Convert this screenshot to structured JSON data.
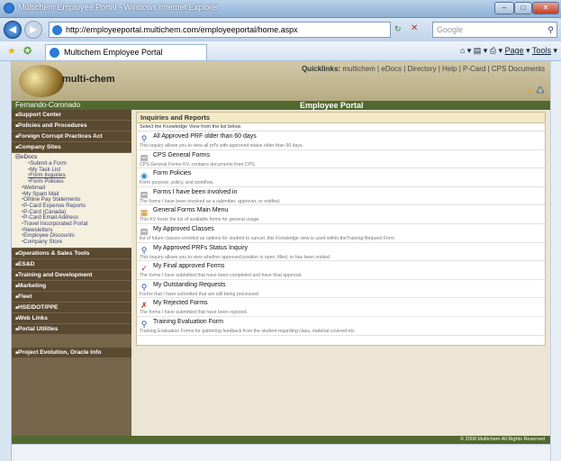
{
  "window": {
    "title": "Multichem Employee Portal - Windows Internet Explorer"
  },
  "address": {
    "url": "http://employeeportal.multichem.com/employeeportal/home.aspx",
    "search_placeholder": "Google"
  },
  "tab": {
    "label": "Multichem Employee Portal"
  },
  "toolbar": {
    "page": "Page",
    "tools": "Tools"
  },
  "header": {
    "logo_text": "multi-chem",
    "quicklinks_label": "Quicklinks:",
    "quicklinks": "multichem | eDocs | Directory | Help | P-Card | CPS Documents"
  },
  "banner": {
    "user": "Fernando-Coronado",
    "portal_title": "Employee Portal"
  },
  "sidebar": {
    "s1": "Support Center",
    "s2": "Policies and Procedures",
    "s3": "Foreign Corrupt Practices Act",
    "s4": "Company Sites",
    "edocs": "eDocs",
    "e1": "Submit a Form",
    "e2": "My Task List",
    "e3": "Form Inquiries",
    "e4": "Form Policies",
    "l1": "Webmail",
    "l2": "My Spam Mail",
    "l3": "Online Pay Statements",
    "l4": "P-Card Expense Reports",
    "l5": "P-Card (Canada)",
    "l6": "P-Card Email Address",
    "l7": "Travel Incorporated Portal",
    "l8": "Newsletters",
    "l9": "Employee Discounts",
    "l10": "Company Store",
    "s5": "Operations & Sales Tools",
    "s6": "ES&D",
    "s7": "Training and Development",
    "s8": "Marketing",
    "s9": "Fleet",
    "s10": "HSE/DOT/PPE",
    "s11": "Web Links",
    "s12": "Portal Utilities",
    "s13": "Project Evolution, Oracle Info"
  },
  "panel": {
    "title": "Inquiries and Reports",
    "select_hint": "Select the Knowledge View from the list below",
    "items": [
      {
        "icon": "magnifier-icon",
        "title": "All Approved PRF older than 60 days",
        "desc": "This inquiry allows you to view all prf's with approved status older than 60 days."
      },
      {
        "icon": "document-icon",
        "title": "CPS General Forms",
        "desc": "CPS General Forms KV, contains documents from CPS."
      },
      {
        "icon": "globe-icon",
        "title": "Form Policies",
        "desc": "Form purpose, policy, and workflow."
      },
      {
        "icon": "document-icon",
        "title": "Forms I have been involved in",
        "desc": "The forms I have been involved as a submitter, approver, or notified."
      },
      {
        "icon": "book-icon",
        "title": "General Forms Main Menu",
        "desc": "This KV hosts the list of available forms for general usage."
      },
      {
        "icon": "document-icon",
        "title": "My Approved Classes",
        "desc": "list of future classes enrolled as options for student to cancel; this Knowledge view is used within theTraining Request Form."
      },
      {
        "icon": "magnifier-icon",
        "title": "My Approved PRFs Status Inquiry",
        "desc": "This inquiry allows you to view whether approved position is open, filled, or has been voided."
      },
      {
        "icon": "checkmark-icon",
        "title": "My Final approved Forms",
        "desc": "The forms I have submitted that have been completed and have final approval."
      },
      {
        "icon": "magnifier-icon",
        "title": "My Outstanding Requests",
        "desc": "Forms that I have submitted that are still being processed."
      },
      {
        "icon": "x-icon",
        "title": "My Rejected Forms",
        "desc": "The forms I have submitted that have been rejected."
      },
      {
        "icon": "magnifier-icon",
        "title": "Training Evaluation Form",
        "desc": "Training Evaluation Forms for gathering feedback from the student regarding class, material covered etc."
      }
    ]
  },
  "footer": {
    "copyright": "© 2008 Multichem All Rights Reserved"
  },
  "colors": {
    "sidebar": "#76654a",
    "banner": "#51692f",
    "header": "#c5b994"
  }
}
